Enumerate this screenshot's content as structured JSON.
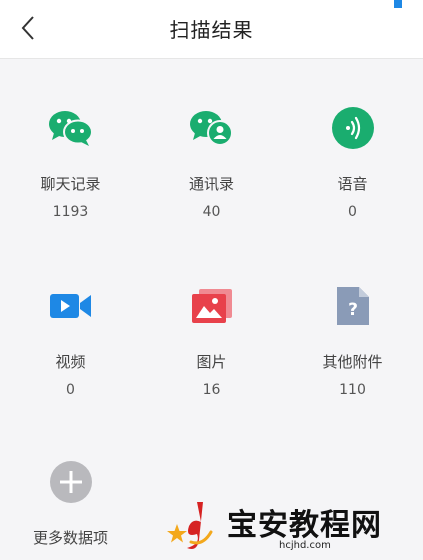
{
  "header": {
    "title": "扫描结果",
    "back_icon": "chevron-left-icon"
  },
  "items": [
    {
      "label": "聊天记录",
      "count": "1193",
      "icon": "wechat-chat-icon",
      "color": "#1aad6f"
    },
    {
      "label": "通讯录",
      "count": "40",
      "icon": "wechat-contacts-icon",
      "color": "#1aad6f"
    },
    {
      "label": "语音",
      "count": "0",
      "icon": "voice-icon",
      "color": "#1aad6f"
    },
    {
      "label": "视频",
      "count": "0",
      "icon": "video-icon",
      "color": "#1e88e5"
    },
    {
      "label": "图片",
      "count": "16",
      "icon": "image-icon",
      "color": "#e8414b"
    },
    {
      "label": "其他附件",
      "count": "110",
      "icon": "file-unknown-icon",
      "color": "#8a9bb7"
    },
    {
      "label": "更多数据项",
      "icon": "plus-circle-icon",
      "color": "#b9b9bd"
    }
  ],
  "watermark": {
    "text": "宝安教程网",
    "url": "hcjhd.com"
  }
}
